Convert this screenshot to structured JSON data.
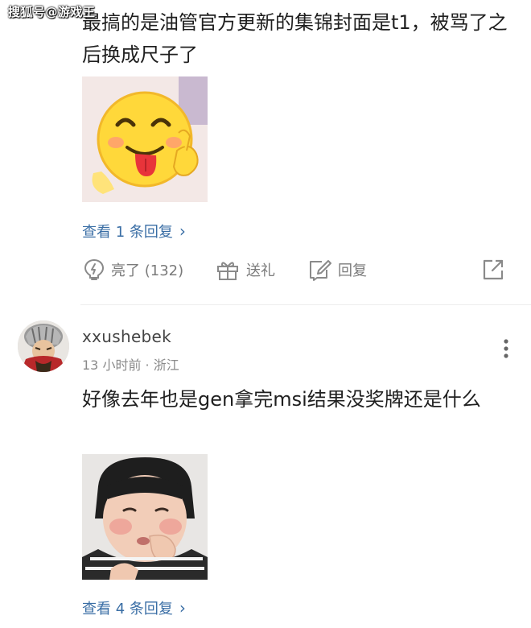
{
  "watermark": "搜狐号@游戏王",
  "comment1": {
    "text": "最搞的是油管官方更新的集锦封面是t1，被骂了之后换成尺子了",
    "sticker": "laughing-emoji-sticker",
    "view_replies": "查看 1 条回复",
    "actions": {
      "like_label": "亮了 (132)",
      "gift_label": "送礼",
      "reply_label": "回复"
    }
  },
  "comment2": {
    "username": "xxushebek",
    "meta": "13 小时前 · 浙江",
    "text": "好像去年也是gen拿完msi结果没奖牌还是什么",
    "sticker": "baby-face-sticker",
    "view_replies": "查看 4 条回复"
  },
  "colors": {
    "link": "#3a6ea5",
    "action_gray": "#7a7a7a",
    "text": "#1f1f1f",
    "meta": "#8a8a8a"
  },
  "icons": {
    "like": "lightbulb-icon",
    "gift": "gift-icon",
    "reply": "edit-icon",
    "share": "share-icon",
    "more": "more-vertical-icon",
    "chevron": "chevron-right-icon"
  }
}
